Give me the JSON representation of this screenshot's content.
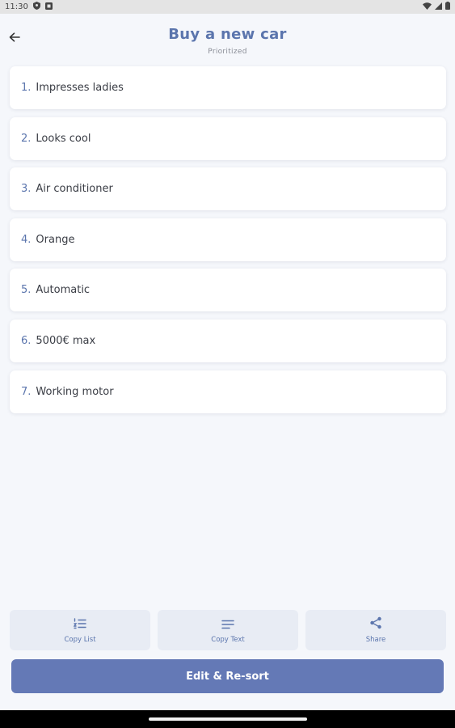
{
  "status_bar": {
    "time": "11:30"
  },
  "header": {
    "title": "Buy a new car",
    "subtitle": "Prioritized"
  },
  "items": [
    {
      "num": "1.",
      "label": "Impresses ladies"
    },
    {
      "num": "2.",
      "label": "Looks cool"
    },
    {
      "num": "3.",
      "label": "Air conditioner"
    },
    {
      "num": "4.",
      "label": "Orange"
    },
    {
      "num": "5.",
      "label": "Automatic"
    },
    {
      "num": "6.",
      "label": "5000€ max"
    },
    {
      "num": "7.",
      "label": "Working motor"
    }
  ],
  "actions": {
    "copy_list": {
      "label": "Copy List",
      "icon": "list-numbered-icon"
    },
    "copy_text": {
      "label": "Copy Text",
      "icon": "text-lines-icon"
    },
    "share": {
      "label": "Share",
      "icon": "share-icon"
    }
  },
  "primary_button": {
    "label": "Edit & Re-sort"
  },
  "colors": {
    "accent": "#5b75ad",
    "button": "#6479b6",
    "background": "#f5f7fb",
    "action_bg": "#e8ecf4"
  }
}
